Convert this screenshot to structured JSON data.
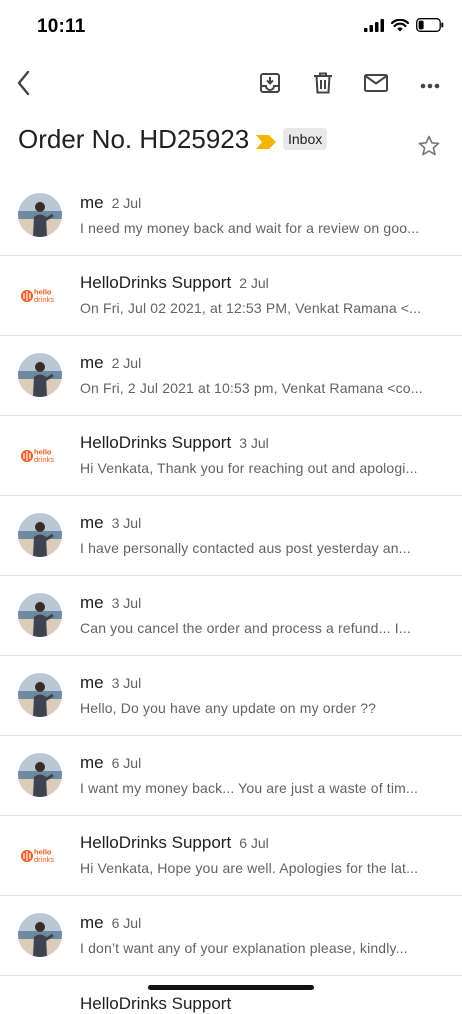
{
  "status_bar": {
    "time": "10:11"
  },
  "toolbar": {
    "back_icon": "chevron-left-icon",
    "archive_icon": "archive-icon",
    "delete_icon": "trash-icon",
    "mark_unread_icon": "mail-icon",
    "more_icon": "more-horizontal-icon"
  },
  "subject": {
    "title": "Order No. HD25923",
    "label": "Inbox",
    "label_color": "#f4b400"
  },
  "messages": [
    {
      "sender": "me",
      "date": "2 Jul",
      "snippet": "I need my money back and wait for a review on goo...",
      "avatar": "photo"
    },
    {
      "sender": "HelloDrinks Support",
      "date": "2 Jul",
      "snippet": "On Fri, Jul 02 2021, at 12:53 PM, Venkat Ramana <...",
      "avatar": "hellodrinks"
    },
    {
      "sender": "me",
      "date": "2 Jul",
      "snippet": "On Fri, 2 Jul 2021 at 10:53 pm, Venkat Ramana <co...",
      "avatar": "photo"
    },
    {
      "sender": "HelloDrinks Support",
      "date": "3 Jul",
      "snippet": "Hi Venkata, Thank you for reaching out and apologi...",
      "avatar": "hellodrinks"
    },
    {
      "sender": "me",
      "date": "3 Jul",
      "snippet": "I have personally contacted aus post yesterday an...",
      "avatar": "photo"
    },
    {
      "sender": "me",
      "date": "3 Jul",
      "snippet": "Can you cancel the order and process a refund... I...",
      "avatar": "photo"
    },
    {
      "sender": "me",
      "date": "3 Jul",
      "snippet": "Hello, Do you have any update on my order ??",
      "avatar": "photo"
    },
    {
      "sender": "me",
      "date": "6 Jul",
      "snippet": "I want my money back... You are just a waste of tim...",
      "avatar": "photo"
    },
    {
      "sender": "HelloDrinks Support",
      "date": "6 Jul",
      "snippet": "Hi Venkata, Hope you are well. Apologies for the lat...",
      "avatar": "hellodrinks"
    },
    {
      "sender": "me",
      "date": "6 Jul",
      "snippet": "I don’t want any of your explanation please, kindly...",
      "avatar": "photo"
    }
  ],
  "logo": {
    "line1": "hello",
    "line2": "drinks",
    "color": "#f15a24"
  },
  "partial_row": {
    "sender": "HelloDrinks Support"
  }
}
